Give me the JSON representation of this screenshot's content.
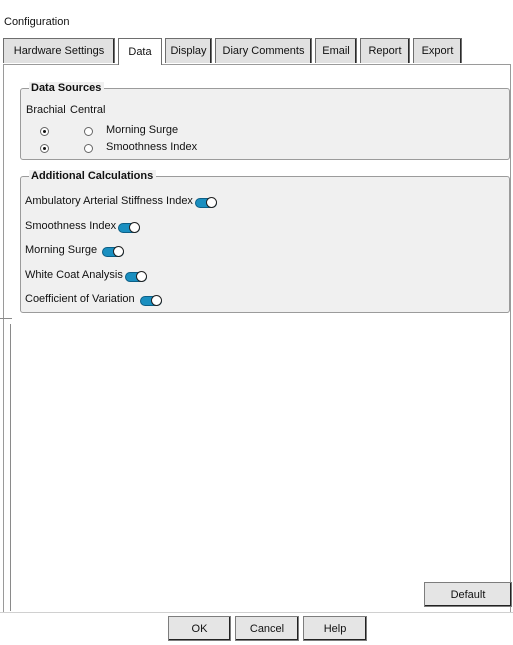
{
  "window": {
    "title": "Configuration"
  },
  "tabs": [
    {
      "label": "Hardware Settings",
      "active": false
    },
    {
      "label": "Data",
      "active": true
    },
    {
      "label": "Display",
      "active": false
    },
    {
      "label": "Diary Comments",
      "active": false
    },
    {
      "label": "Email",
      "active": false
    },
    {
      "label": "Report",
      "active": false
    },
    {
      "label": "Export",
      "active": false
    }
  ],
  "data_sources": {
    "legend": "Data Sources",
    "col_brachial": "Brachial",
    "col_central": "Central",
    "rows": [
      {
        "label": "Morning Surge",
        "brachial_selected": true,
        "central_selected": false
      },
      {
        "label": "Smoothness Index",
        "brachial_selected": true,
        "central_selected": false
      }
    ]
  },
  "additional_calculations": {
    "legend": "Additional Calculations",
    "items": [
      {
        "label": "Ambulatory Arterial Stiffness Index",
        "enabled": true
      },
      {
        "label": "Smoothness Index",
        "enabled": true
      },
      {
        "label": "Morning Surge",
        "enabled": true
      },
      {
        "label": "White Coat Analysis",
        "enabled": true
      },
      {
        "label": "Coefficient of Variation",
        "enabled": true
      }
    ]
  },
  "buttons": {
    "default_label": "Default",
    "ok_label": "OK",
    "cancel_label": "Cancel",
    "help_label": "Help"
  },
  "colors": {
    "toggle_on": "#1a8fc0",
    "panel_bg": "#f0f0f0"
  }
}
